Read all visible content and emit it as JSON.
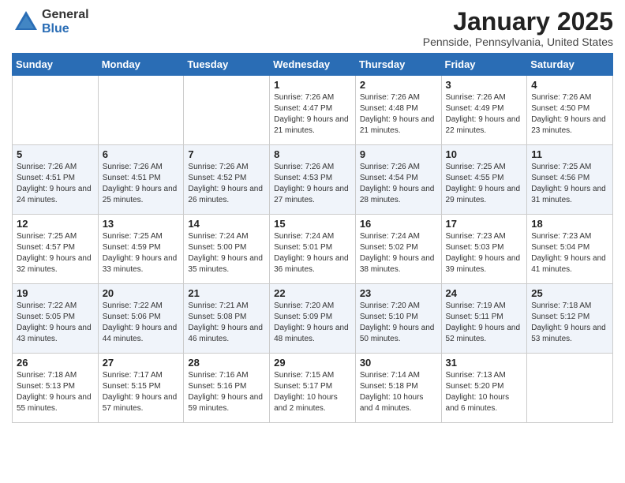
{
  "header": {
    "logo_general": "General",
    "logo_blue": "Blue",
    "month_title": "January 2025",
    "location": "Pennside, Pennsylvania, United States"
  },
  "weekdays": [
    "Sunday",
    "Monday",
    "Tuesday",
    "Wednesday",
    "Thursday",
    "Friday",
    "Saturday"
  ],
  "weeks": [
    [
      {
        "day": "",
        "info": ""
      },
      {
        "day": "",
        "info": ""
      },
      {
        "day": "",
        "info": ""
      },
      {
        "day": "1",
        "info": "Sunrise: 7:26 AM\nSunset: 4:47 PM\nDaylight: 9 hours and 21 minutes."
      },
      {
        "day": "2",
        "info": "Sunrise: 7:26 AM\nSunset: 4:48 PM\nDaylight: 9 hours and 21 minutes."
      },
      {
        "day": "3",
        "info": "Sunrise: 7:26 AM\nSunset: 4:49 PM\nDaylight: 9 hours and 22 minutes."
      },
      {
        "day": "4",
        "info": "Sunrise: 7:26 AM\nSunset: 4:50 PM\nDaylight: 9 hours and 23 minutes."
      }
    ],
    [
      {
        "day": "5",
        "info": "Sunrise: 7:26 AM\nSunset: 4:51 PM\nDaylight: 9 hours and 24 minutes."
      },
      {
        "day": "6",
        "info": "Sunrise: 7:26 AM\nSunset: 4:51 PM\nDaylight: 9 hours and 25 minutes."
      },
      {
        "day": "7",
        "info": "Sunrise: 7:26 AM\nSunset: 4:52 PM\nDaylight: 9 hours and 26 minutes."
      },
      {
        "day": "8",
        "info": "Sunrise: 7:26 AM\nSunset: 4:53 PM\nDaylight: 9 hours and 27 minutes."
      },
      {
        "day": "9",
        "info": "Sunrise: 7:26 AM\nSunset: 4:54 PM\nDaylight: 9 hours and 28 minutes."
      },
      {
        "day": "10",
        "info": "Sunrise: 7:25 AM\nSunset: 4:55 PM\nDaylight: 9 hours and 29 minutes."
      },
      {
        "day": "11",
        "info": "Sunrise: 7:25 AM\nSunset: 4:56 PM\nDaylight: 9 hours and 31 minutes."
      }
    ],
    [
      {
        "day": "12",
        "info": "Sunrise: 7:25 AM\nSunset: 4:57 PM\nDaylight: 9 hours and 32 minutes."
      },
      {
        "day": "13",
        "info": "Sunrise: 7:25 AM\nSunset: 4:59 PM\nDaylight: 9 hours and 33 minutes."
      },
      {
        "day": "14",
        "info": "Sunrise: 7:24 AM\nSunset: 5:00 PM\nDaylight: 9 hours and 35 minutes."
      },
      {
        "day": "15",
        "info": "Sunrise: 7:24 AM\nSunset: 5:01 PM\nDaylight: 9 hours and 36 minutes."
      },
      {
        "day": "16",
        "info": "Sunrise: 7:24 AM\nSunset: 5:02 PM\nDaylight: 9 hours and 38 minutes."
      },
      {
        "day": "17",
        "info": "Sunrise: 7:23 AM\nSunset: 5:03 PM\nDaylight: 9 hours and 39 minutes."
      },
      {
        "day": "18",
        "info": "Sunrise: 7:23 AM\nSunset: 5:04 PM\nDaylight: 9 hours and 41 minutes."
      }
    ],
    [
      {
        "day": "19",
        "info": "Sunrise: 7:22 AM\nSunset: 5:05 PM\nDaylight: 9 hours and 43 minutes."
      },
      {
        "day": "20",
        "info": "Sunrise: 7:22 AM\nSunset: 5:06 PM\nDaylight: 9 hours and 44 minutes."
      },
      {
        "day": "21",
        "info": "Sunrise: 7:21 AM\nSunset: 5:08 PM\nDaylight: 9 hours and 46 minutes."
      },
      {
        "day": "22",
        "info": "Sunrise: 7:20 AM\nSunset: 5:09 PM\nDaylight: 9 hours and 48 minutes."
      },
      {
        "day": "23",
        "info": "Sunrise: 7:20 AM\nSunset: 5:10 PM\nDaylight: 9 hours and 50 minutes."
      },
      {
        "day": "24",
        "info": "Sunrise: 7:19 AM\nSunset: 5:11 PM\nDaylight: 9 hours and 52 minutes."
      },
      {
        "day": "25",
        "info": "Sunrise: 7:18 AM\nSunset: 5:12 PM\nDaylight: 9 hours and 53 minutes."
      }
    ],
    [
      {
        "day": "26",
        "info": "Sunrise: 7:18 AM\nSunset: 5:13 PM\nDaylight: 9 hours and 55 minutes."
      },
      {
        "day": "27",
        "info": "Sunrise: 7:17 AM\nSunset: 5:15 PM\nDaylight: 9 hours and 57 minutes."
      },
      {
        "day": "28",
        "info": "Sunrise: 7:16 AM\nSunset: 5:16 PM\nDaylight: 9 hours and 59 minutes."
      },
      {
        "day": "29",
        "info": "Sunrise: 7:15 AM\nSunset: 5:17 PM\nDaylight: 10 hours and 2 minutes."
      },
      {
        "day": "30",
        "info": "Sunrise: 7:14 AM\nSunset: 5:18 PM\nDaylight: 10 hours and 4 minutes."
      },
      {
        "day": "31",
        "info": "Sunrise: 7:13 AM\nSunset: 5:20 PM\nDaylight: 10 hours and 6 minutes."
      },
      {
        "day": "",
        "info": ""
      }
    ]
  ]
}
